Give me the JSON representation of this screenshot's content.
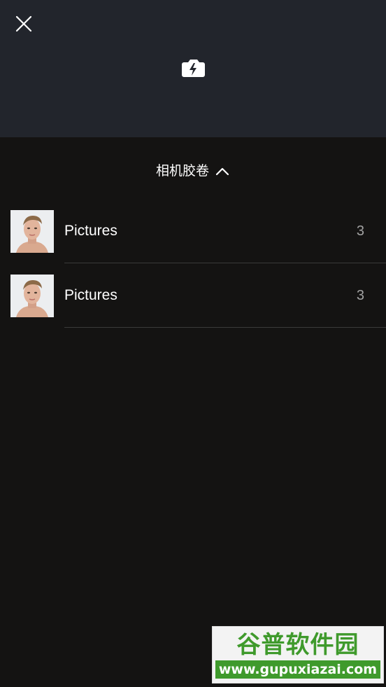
{
  "header": {
    "close_icon": "close-icon",
    "camera_icon": "camera-flash-icon"
  },
  "album_selector": {
    "label": "相机胶卷",
    "chevron_icon": "chevron-up-icon"
  },
  "albums": [
    {
      "name": "Pictures",
      "count": "3",
      "thumbnail": "face-portrait-thumbnail"
    },
    {
      "name": "Pictures",
      "count": "3",
      "thumbnail": "face-portrait-thumbnail"
    }
  ],
  "watermark": {
    "title": "谷普软件园",
    "url": "www.gupuxiazai.com"
  },
  "colors": {
    "topbar": "#22252c",
    "background": "#141312",
    "text": "#ffffff",
    "count": "#a2a2a2",
    "watermark_green": "#3f9a2c"
  }
}
